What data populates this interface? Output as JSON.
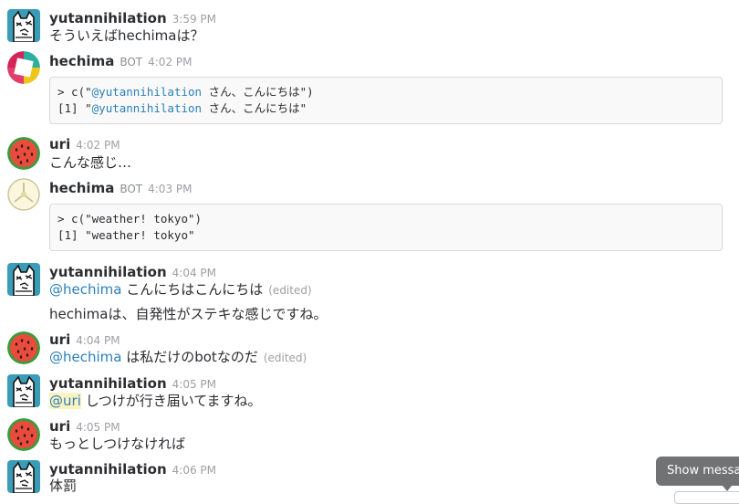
{
  "messages": [
    {
      "user": "yutannihilation",
      "time": "3:59 PM",
      "text": "そういえばhechimaは？"
    },
    {
      "user": "hechima",
      "badge": "BOT",
      "time": "4:02 PM",
      "code": {
        "l1_pre": "> c(\"",
        "l1_mention": "@yutannihilation",
        "l1_post": " さん、こんにちは\")",
        "l2_pre": "[1] \"",
        "l2_mention": "@yutannihilation",
        "l2_post": " さん、こんにちは\""
      }
    },
    {
      "user": "uri",
      "time": "4:02 PM",
      "text": "こんな感じ…"
    },
    {
      "user": "hechima",
      "badge": "BOT",
      "time": "4:03 PM",
      "code": {
        "l1": "> c(\"weather! tokyo\")",
        "l2": "[1] \"weather! tokyo\""
      }
    },
    {
      "user": "yutannihilation",
      "time": "4:04 PM",
      "mention": "@hechima",
      "text": " こんにちはこんにちは",
      "edited": "(edited)",
      "text2": "hechimaは、自発性がステキな感じですね。"
    },
    {
      "user": "uri",
      "time": "4:04 PM",
      "mention": "@hechima",
      "text": " は私だけのbotなのだ",
      "edited": "(edited)"
    },
    {
      "user": "yutannihilation",
      "time": "4:05 PM",
      "mention": "@uri",
      "text": " しつけが行き届いてますね。"
    },
    {
      "user": "uri",
      "time": "4:05 PM",
      "text": "もっとしつけなければ"
    },
    {
      "user": "yutannihilation",
      "time": "4:06 PM",
      "text": "体罰"
    }
  ],
  "toast": {
    "label": "Show messages"
  },
  "colors": {
    "mention": "#2a80b9",
    "mention_highlight": "#fdf2c0",
    "toast_bg": "#717274"
  }
}
